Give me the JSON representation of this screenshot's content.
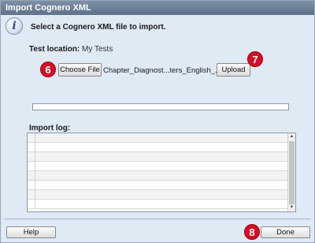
{
  "dialog": {
    "title": "Import Cognero XML",
    "instruction": "Select a Cognero XML file to import.",
    "test_location_label": "Test location:",
    "test_location_value": "My Tests",
    "choose_file_label": "Choose File",
    "file_name": "Chapter_Diagnost...ters_English_.xml",
    "upload_label": "Upload",
    "progress_fraction": 0,
    "import_log_label": "Import log:",
    "help_label": "Help",
    "done_label": "Done"
  },
  "callouts": {
    "choose_file": "6",
    "upload": "7",
    "done": "8"
  },
  "colors": {
    "callout": "#d0102a",
    "titlebar": "#6a7d94",
    "dialog_bg": "#dfeaf5"
  },
  "icons": {
    "info": "information-icon"
  }
}
